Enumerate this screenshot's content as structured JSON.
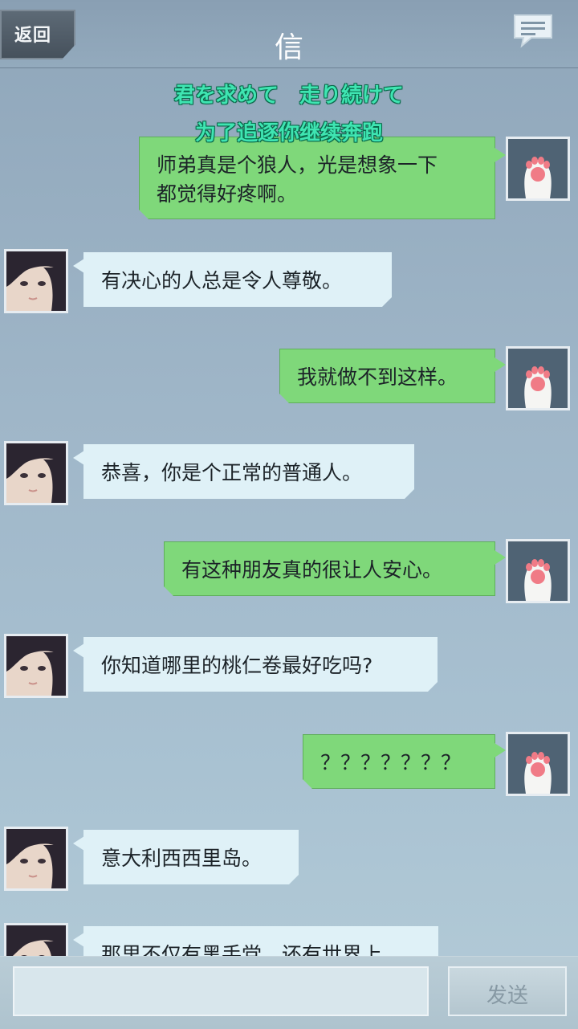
{
  "header": {
    "back_label": "返回",
    "title": "信"
  },
  "lyrics": {
    "line1": "君を求めて　走り続けて",
    "line2": "为了追逐你继续奔跑"
  },
  "messages": [
    {
      "sender": "me",
      "text_lines": [
        "师弟真是个狼人，光是想象一下",
        "都觉得好疼啊。"
      ]
    },
    {
      "sender": "them",
      "text": "有决心的人总是令人尊敬。"
    },
    {
      "sender": "me",
      "text": "我就做不到这样。"
    },
    {
      "sender": "them",
      "text": "恭喜，你是个正常的普通人。"
    },
    {
      "sender": "me",
      "text": "有这种朋友真的很让人安心。"
    },
    {
      "sender": "them",
      "text": "你知道哪里的桃仁卷最好吃吗?"
    },
    {
      "sender": "me",
      "text": "？？？？？？？"
    },
    {
      "sender": "them",
      "text": "意大利西西里岛。"
    },
    {
      "sender": "them",
      "text": "那里不仅有黑手党，还有世界上"
    }
  ],
  "composer": {
    "input_value": "",
    "send_label": "发送"
  },
  "colors": {
    "my_bubble": "#7fd87a",
    "their_bubble": "#dff1f7",
    "lyric_text": "#3fe5b2"
  }
}
